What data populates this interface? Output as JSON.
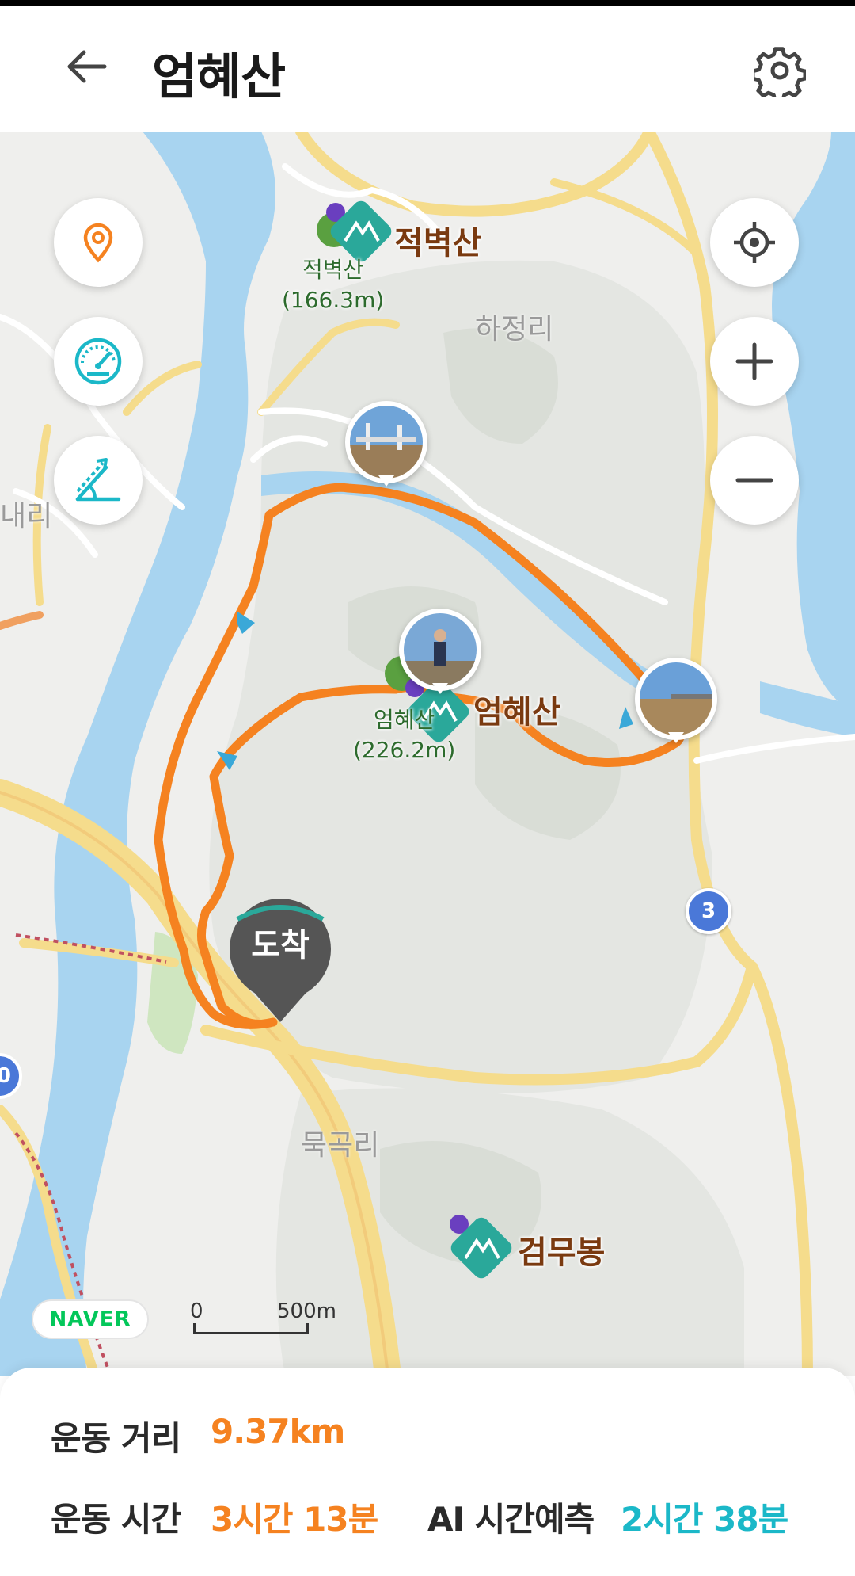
{
  "header": {
    "title": "엄혜산",
    "back_icon": "arrow-left-icon",
    "settings_icon": "gear-icon"
  },
  "map": {
    "peaks": [
      {
        "name": "적벽산",
        "small_name": "적벽산",
        "elevation": "(166.3m)"
      },
      {
        "name": "엄혜산",
        "small_name": "엄혜산",
        "elevation": "(226.2m)"
      },
      {
        "name": "검무봉"
      }
    ],
    "villages": [
      "하정리",
      "묵곡리",
      "내리"
    ],
    "arrival_pin": "도착",
    "route_badge": "3",
    "route_badge_left": "0",
    "naver_logo": "NAVER",
    "scale": {
      "start": "0",
      "end": "500m"
    },
    "controls": {
      "left": [
        "location-pin-icon",
        "speedometer-icon",
        "slope-icon"
      ],
      "right": [
        "my-location-icon",
        "zoom-in-icon",
        "zoom-out-icon"
      ]
    },
    "colors": {
      "route": "#f58220",
      "river": "#a8d4f0",
      "road": "#f5dc8c",
      "peak_marker": "#2aa89a"
    }
  },
  "stats": {
    "distance_label": "운동 거리",
    "distance_value": "9.37km",
    "time_label": "운동 시간",
    "time_value": "3시간 13분",
    "ai_label": "AI 시간예측",
    "ai_value": "2시간 38분"
  }
}
